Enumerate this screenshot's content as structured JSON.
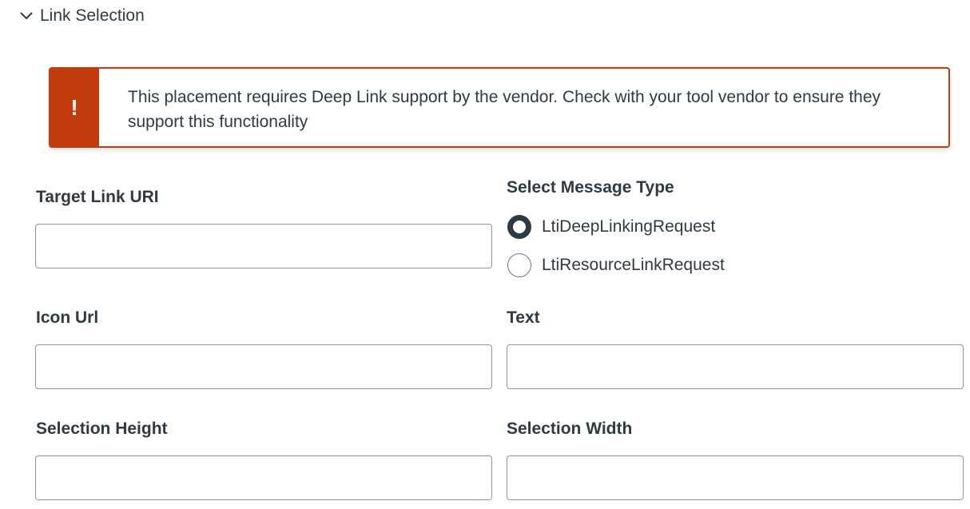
{
  "section": {
    "title": "Link Selection",
    "toggle_icon": "chevron-down-icon"
  },
  "alert": {
    "icon": "exclamation-icon",
    "icon_glyph": "!",
    "message": "This placement requires Deep Link support by the vendor. Check with your tool vendor to ensure they support this functionality",
    "color": "#c23c0d"
  },
  "fields": {
    "target_link_uri": {
      "label": "Target Link URI",
      "value": "",
      "placeholder": ""
    },
    "icon_url": {
      "label": "Icon Url",
      "value": "",
      "placeholder": ""
    },
    "text": {
      "label": "Text",
      "value": "",
      "placeholder": ""
    },
    "selection_height": {
      "label": "Selection Height",
      "value": "",
      "placeholder": ""
    },
    "selection_width": {
      "label": "Selection Width",
      "value": "",
      "placeholder": ""
    }
  },
  "message_type": {
    "label": "Select Message Type",
    "options": [
      {
        "label": "LtiDeepLinkingRequest",
        "checked": true
      },
      {
        "label": "LtiResourceLinkRequest",
        "checked": false
      }
    ]
  },
  "colors": {
    "text": "#2d3b45",
    "input_border": "#8b969e",
    "alert": "#c23c0d"
  }
}
